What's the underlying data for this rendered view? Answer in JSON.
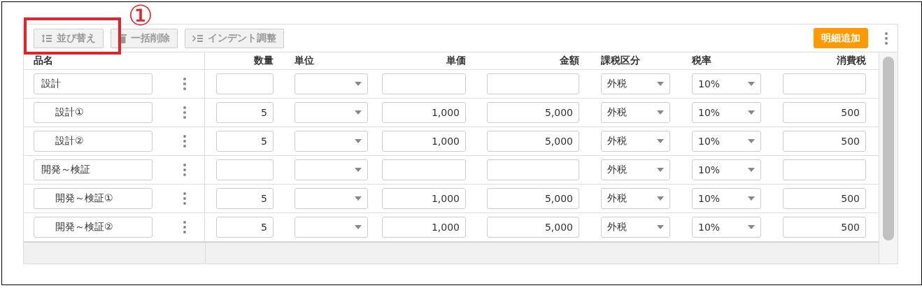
{
  "toolbar": {
    "buttons": [
      {
        "label": "並び替え",
        "kind": "sort",
        "disabled": true
      },
      {
        "label": "一括削除",
        "kind": "delete",
        "disabled": true
      },
      {
        "label": "インデント調整",
        "kind": "indent",
        "disabled": true
      }
    ],
    "add_button": "明細追加"
  },
  "annotation": {
    "marker": "①"
  },
  "columns": [
    {
      "label": "品名"
    },
    {
      "label": "数量"
    },
    {
      "label": "単位"
    },
    {
      "label": "単価"
    },
    {
      "label": "金額"
    },
    {
      "label": "課税区分"
    },
    {
      "label": "税率"
    },
    {
      "label": "消費税"
    }
  ],
  "rows": [
    {
      "name": "設計",
      "tax_type": "外税",
      "tax_rate": "10%",
      "children": [
        {
          "name": "設計①",
          "quantity": "5",
          "unit_price": "1,000",
          "amount": "5,000",
          "tax_type": "外税",
          "tax_rate": "10%",
          "tax": "500"
        },
        {
          "name": "設計②",
          "quantity": "5",
          "unit_price": "1,000",
          "amount": "5,000",
          "tax_type": "外税",
          "tax_rate": "10%",
          "tax": "500"
        }
      ]
    },
    {
      "name": "開発～検証",
      "tax_type": "外税",
      "tax_rate": "10%",
      "children": [
        {
          "name": "開発～検証①",
          "quantity": "5",
          "unit_price": "1,000",
          "amount": "5,000",
          "tax_type": "外税",
          "tax_rate": "10%",
          "tax": "500"
        },
        {
          "name": "開発～検証②",
          "quantity": "5",
          "unit_price": "1,000",
          "amount": "5,000",
          "tax_type": "外税",
          "tax_rate": "10%",
          "tax": "500"
        }
      ]
    }
  ]
}
